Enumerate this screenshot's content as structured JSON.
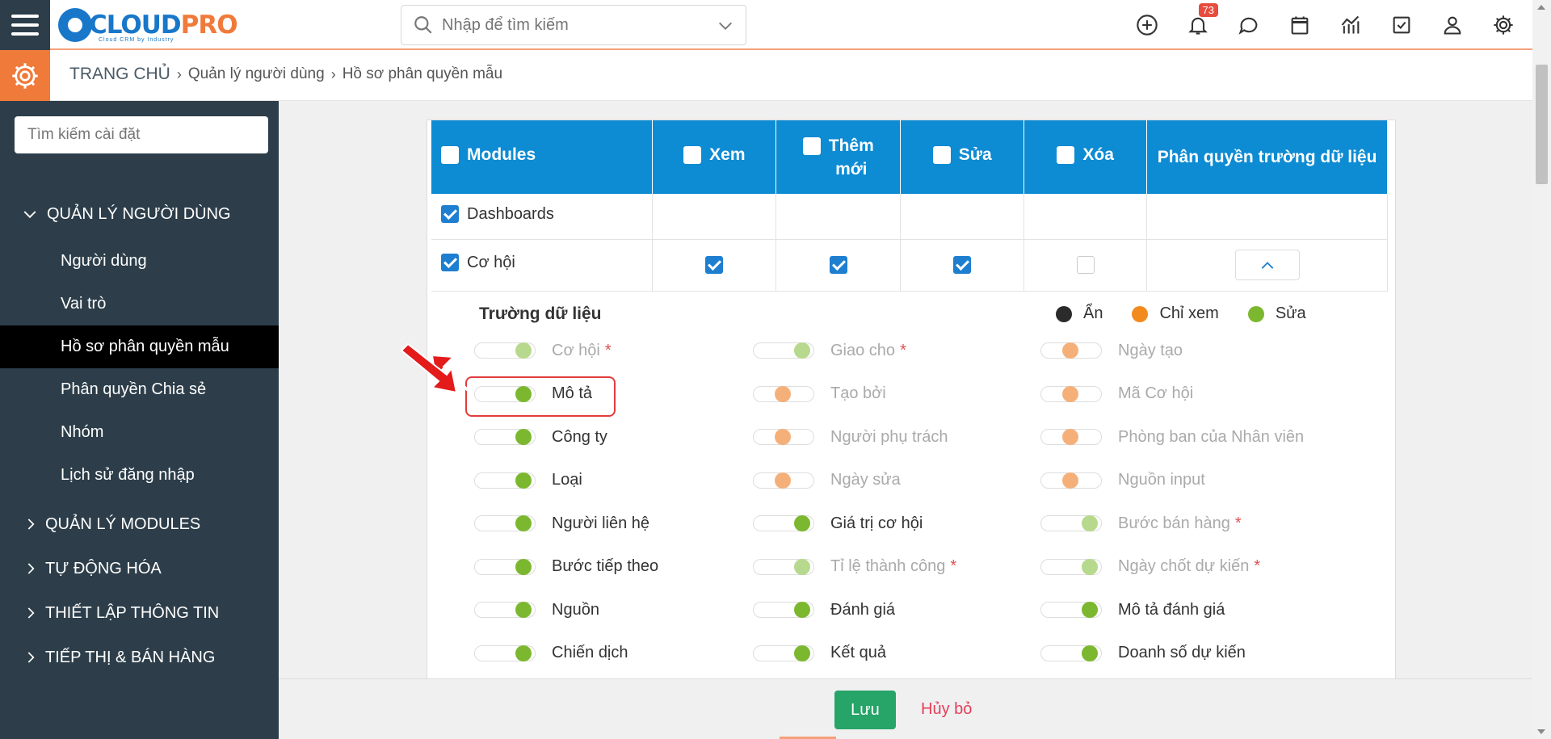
{
  "header": {
    "logo_text_cloud": "CLOUD",
    "logo_text_pro": "PRO",
    "logo_sub": "Cloud CRM by Industry",
    "search_placeholder": "Nhập để tìm kiếm",
    "notification_count": "73",
    "icons": [
      "plus-circle-icon",
      "bell-icon",
      "chat-icon",
      "calendar-icon",
      "report-chart-icon",
      "task-check-icon",
      "user-icon",
      "settings-gear-icon"
    ]
  },
  "breadcrumb": {
    "home": "TRANG CHỦ",
    "level1": "Quản lý người dùng",
    "level2": "Hồ sơ phân quyền mẫu"
  },
  "sidebar": {
    "search_placeholder": "Tìm kiếm cài đặt",
    "groups": [
      {
        "label": "QUẢN LÝ NGƯỜI DÙNG",
        "expanded": true
      },
      {
        "label": "QUẢN LÝ MODULES",
        "expanded": false
      },
      {
        "label": "TỰ ĐỘNG HÓA",
        "expanded": false
      },
      {
        "label": "THIẾT LẬP THÔNG TIN",
        "expanded": false
      },
      {
        "label": "TIẾP THỊ & BÁN HÀNG",
        "expanded": false
      }
    ],
    "items": [
      {
        "label": "Người dùng",
        "active": false
      },
      {
        "label": "Vai trò",
        "active": false
      },
      {
        "label": "Hồ sơ phân quyền mẫu",
        "active": true
      },
      {
        "label": "Phân quyền Chia sẻ",
        "active": false
      },
      {
        "label": "Nhóm",
        "active": false
      },
      {
        "label": "Lịch sử đăng nhập",
        "active": false
      }
    ]
  },
  "table": {
    "headers": {
      "modules": "Modules",
      "view": "Xem",
      "create_line1": "Thêm",
      "create_line2": "mới",
      "edit": "Sửa",
      "delete": "Xóa",
      "field_perm": "Phân quyền trường dữ liệu"
    },
    "rows": [
      {
        "module": "Dashboards",
        "checked": true
      },
      {
        "module": "Cơ hội",
        "checked": true,
        "view": true,
        "create": true,
        "edit": true,
        "delete": false
      }
    ]
  },
  "fields": {
    "title": "Trường dữ liệu",
    "legend": [
      {
        "label": "Ẩn",
        "color": "#2b2b2b"
      },
      {
        "label": "Chỉ xem",
        "color": "#f28a1e"
      },
      {
        "label": "Sửa",
        "color": "#7cb82f"
      }
    ],
    "required_mark": "*",
    "columns": [
      [
        {
          "label": "Cơ hội",
          "state": "edit-disabled",
          "required": true
        },
        {
          "label": "Mô tả",
          "state": "edit"
        },
        {
          "label": "Công ty",
          "state": "edit"
        },
        {
          "label": "Loại",
          "state": "edit"
        },
        {
          "label": "Người liên hệ",
          "state": "edit"
        },
        {
          "label": "Bước tiếp theo",
          "state": "edit"
        },
        {
          "label": "Nguồn",
          "state": "edit"
        },
        {
          "label": "Chiến dịch",
          "state": "edit"
        }
      ],
      [
        {
          "label": "Giao cho",
          "state": "edit-disabled",
          "required": true
        },
        {
          "label": "Tạo bởi",
          "state": "readonly-disabled"
        },
        {
          "label": "Người phụ trách",
          "state": "readonly-disabled"
        },
        {
          "label": "Ngày sửa",
          "state": "readonly-disabled"
        },
        {
          "label": "Giá trị cơ hội",
          "state": "edit"
        },
        {
          "label": "Tỉ lệ thành công",
          "state": "edit-disabled",
          "required": true
        },
        {
          "label": "Đánh giá",
          "state": "edit"
        },
        {
          "label": "Kết quả",
          "state": "edit"
        }
      ],
      [
        {
          "label": "Ngày tạo",
          "state": "readonly-disabled"
        },
        {
          "label": "Mã Cơ hội",
          "state": "readonly-disabled"
        },
        {
          "label": "Phòng ban của Nhân viên",
          "state": "readonly-disabled"
        },
        {
          "label": "Nguồn input",
          "state": "readonly-disabled"
        },
        {
          "label": "Bước bán hàng",
          "state": "edit-disabled",
          "required": true
        },
        {
          "label": "Ngày chốt dự kiến",
          "state": "edit-disabled",
          "required": true
        },
        {
          "label": "Mô tả đánh giá",
          "state": "edit"
        },
        {
          "label": "Doanh số dự kiến",
          "state": "edit"
        }
      ]
    ]
  },
  "footer": {
    "save_label": "Lưu",
    "cancel_label": "Hủy bỏ"
  },
  "colors": {
    "sidebar_bg": "#2d3e4a",
    "table_header": "#0d8bd3",
    "accent_orange": "#f07a3a",
    "save_green": "#27a468",
    "knob_edit": "#7cb82f",
    "knob_readonly": "#f5a35a"
  }
}
